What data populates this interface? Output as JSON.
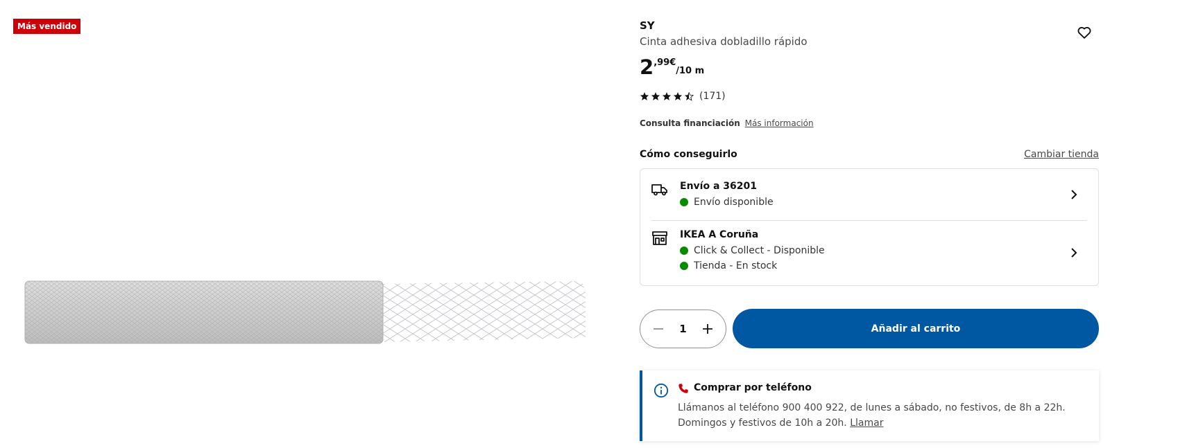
{
  "badge": {
    "label": "Más vendido",
    "color": "#cc0008"
  },
  "product": {
    "brand": "SY",
    "description": "Cinta adhesiva dobladillo rápido",
    "price_integer": "2",
    "price_decimal": ",99€",
    "price_unit": "/10 m",
    "rating_value": 4.5,
    "rating_max": 5,
    "rating_count": "(171)"
  },
  "finance": {
    "label": "Consulta financiación",
    "link": "Más información"
  },
  "get_it": {
    "title": "Cómo conseguirlo",
    "change_store": "Cambiar tienda",
    "delivery": {
      "title": "Envío a 36201",
      "status": "Envío disponible"
    },
    "store": {
      "title": "IKEA A Coruña",
      "status1": "Click & Collect - Disponible",
      "status2": "Tienda - En stock"
    },
    "status_color": "#0a8a00"
  },
  "purchase": {
    "quantity": "1",
    "add_to_cart": "Añadir al carrito",
    "button_color": "#0058a3"
  },
  "phone": {
    "title": "Comprar por teléfono",
    "text": "Llámanos al teléfono 900 400 922, de lunes a sábado, no festivos, de 8h a 22h. Domingos y festivos de 10h a 20h.",
    "call_link": "Llamar"
  },
  "icons": [
    "heart-icon",
    "star-icon",
    "truck-icon",
    "store-icon",
    "chevron-right-icon",
    "minus-icon",
    "plus-icon",
    "info-icon",
    "phone-icon"
  ]
}
